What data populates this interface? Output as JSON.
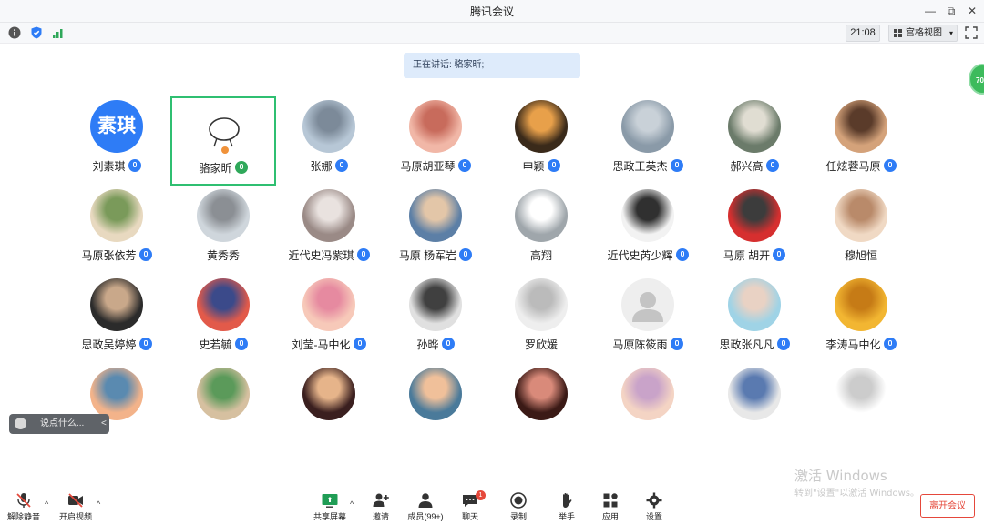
{
  "window": {
    "title": "腾讯会议",
    "minimize": "—",
    "restore": "⧉",
    "close": "✕"
  },
  "toolbar": {
    "time": "21:08",
    "view_mode": "宫格视图",
    "view_caret": "▾"
  },
  "speaking_banner": "正在讲话: 骆家昕;",
  "side_badge": "70",
  "participants": [
    {
      "name": "刘素琪",
      "avatar_text": "素琪",
      "avatar": "text"
    },
    {
      "name": "骆家昕",
      "avatar": "placeholder",
      "active": true
    },
    {
      "name": "张娜",
      "avatar": "photo"
    },
    {
      "name": "马原胡亚琴",
      "avatar": "photo"
    },
    {
      "name": "申颖",
      "avatar": "photo"
    },
    {
      "name": "思政王英杰",
      "avatar": "photo"
    },
    {
      "name": "郝兴高",
      "avatar": "photo"
    },
    {
      "name": "任炫蓉马原",
      "avatar": "photo"
    },
    {
      "name": "马原张依芳",
      "avatar": "photo"
    },
    {
      "name": "黄秀秀",
      "avatar": "photo"
    },
    {
      "name": "近代史冯紫琪",
      "avatar": "photo"
    },
    {
      "name": "马原 杨军岩",
      "avatar": "photo"
    },
    {
      "name": "高翔",
      "avatar": "photo"
    },
    {
      "name": "近代史芮少辉",
      "avatar": "photo"
    },
    {
      "name": "马原 胡开",
      "avatar": "photo"
    },
    {
      "name": "穆旭恒",
      "avatar": "photo"
    },
    {
      "name": "思政吴婷婷",
      "avatar": "photo"
    },
    {
      "name": "史若毓",
      "avatar": "photo"
    },
    {
      "name": "刘莹-马中化",
      "avatar": "photo"
    },
    {
      "name": "孙晔",
      "avatar": "photo"
    },
    {
      "name": "罗欣媛",
      "avatar": "photo"
    },
    {
      "name": "马原陈筱雨",
      "avatar": "default"
    },
    {
      "name": "思政张凡凡",
      "avatar": "photo"
    },
    {
      "name": "李涛马中化",
      "avatar": "photo"
    },
    {
      "name": "",
      "avatar": "photo"
    },
    {
      "name": "",
      "avatar": "photo"
    },
    {
      "name": "",
      "avatar": "photo"
    },
    {
      "name": "",
      "avatar": "photo"
    },
    {
      "name": "",
      "avatar": "photo"
    },
    {
      "name": "",
      "avatar": "photo"
    },
    {
      "name": "",
      "avatar": "photo"
    },
    {
      "name": "",
      "avatar": "photo"
    }
  ],
  "chat_input": {
    "placeholder": "说点什么...",
    "collapse": "<"
  },
  "bottom_bar": {
    "unmute": "解除静音",
    "start_video": "开启视频",
    "share_screen": "共享屏幕",
    "invite": "邀请",
    "members": "成员(99+)",
    "chat": "聊天",
    "chat_badge": "1",
    "record": "录制",
    "raise_hand": "举手",
    "apps": "应用",
    "settings": "设置",
    "leave": "离开会议",
    "caret": "^"
  },
  "watermark": {
    "line1": "激活 Windows",
    "line2": "转到\"设置\"以激活 Windows。"
  },
  "colors": {
    "accent": "#2e7cf6",
    "active_border": "#2fbf71",
    "leave": "#e5483b"
  }
}
